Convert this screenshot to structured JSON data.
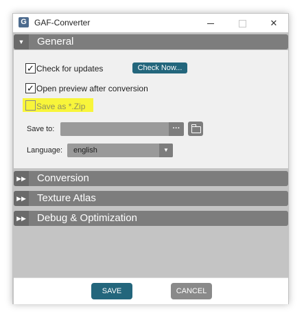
{
  "window": {
    "title": "GAF-Converter",
    "app_icon_letter": "G",
    "minimize_icon": "minimize-icon",
    "maximize_icon": "maximize-icon",
    "close_glyph": "✕"
  },
  "sections": {
    "general": {
      "label": "General",
      "expanded": true,
      "chevron": "▼"
    },
    "conversion": {
      "label": "Conversion",
      "expanded": false,
      "chevron": "▶▶"
    },
    "texture_atlas": {
      "label": "Texture Atlas",
      "expanded": false,
      "chevron": "▶▶"
    },
    "debug": {
      "label": "Debug & Optimization",
      "expanded": false,
      "chevron": "▶▶"
    }
  },
  "general": {
    "check_updates": {
      "label": "Check for updates",
      "checked": true,
      "mark": "✓"
    },
    "check_now_label": "Check Now...",
    "open_preview": {
      "label": "Open preview after conversion",
      "checked": true,
      "mark": "✓"
    },
    "save_as_zip": {
      "label": "Save as *.Zip",
      "checked": false,
      "enabled": false,
      "mark": ""
    },
    "save_to_label": "Save to:",
    "save_to_value": "",
    "browse_label": "···",
    "language_label": "Language:",
    "language_value": "english",
    "language_arrow": "▼"
  },
  "footer": {
    "save_label": "SAVE",
    "cancel_label": "CANCEL"
  },
  "colors": {
    "accent": "#23667c",
    "section_header": "#7d7d7d",
    "highlight": "#f8f53a",
    "panel_bg": "#f0f0f0",
    "window_bg": "#c4c4c4"
  }
}
